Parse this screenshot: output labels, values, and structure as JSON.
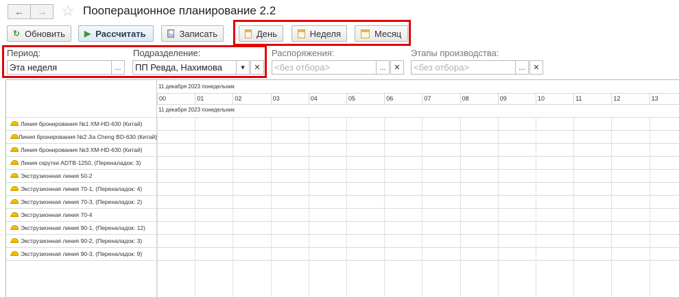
{
  "window": {
    "title": "Пооперационное планирование 2.2"
  },
  "nav": {
    "back_glyph": "←",
    "forward_glyph": "→",
    "favorite_glyph": "☆"
  },
  "toolbar": {
    "refresh_label": "Обновить",
    "calculate_label": "Рассчитать",
    "save_label": "Записать",
    "day_label": "День",
    "week_label": "Неделя",
    "month_label": "Месяц"
  },
  "filters": {
    "period": {
      "label": "Период:",
      "value": "Эта неделя"
    },
    "department": {
      "label": "Подразделение:",
      "value": "ПП Ревда, Нахимова"
    },
    "orders": {
      "label": "Распоряжения:",
      "placeholder": "<без отбора>"
    },
    "stages": {
      "label": "Этапы производства:",
      "placeholder": "<без отбора>"
    }
  },
  "gantt": {
    "date_header": "11 декабря 2023 понедельник",
    "date_subheader": "11 декабря 2023 понедельник",
    "hours": [
      "00",
      "01",
      "02",
      "03",
      "04",
      "05",
      "06",
      "07",
      "08",
      "09",
      "10",
      "11",
      "12",
      "13"
    ],
    "resources": [
      "Линия бронирования №1 XM-HD-630 (Китай)",
      "Линия бронирования №2 Jia Cheng BD-630 (Китай)",
      "Линия бронирования №3 XM-HD-630 (Китай)",
      "Линия скрутки ADTB-1250, (Переналадок: 3)",
      "Экструзионная линия 50-2",
      "Экструзионная линия 70-1, (Переналадок: 4)",
      "Экструзионная линия 70-3, (Переналадок: 2)",
      "Экструзионная линия 70-4",
      "Экструзионная линия 90-1, (Переналадок: 12)",
      "Экструзионная линия 90-2, (Переналадок: 3)",
      "Экструзионная линия 90-3, (Переналадок: 9)"
    ]
  },
  "colors": {
    "highlight_frame": "#e00000",
    "gantt_border": "#a9c98f",
    "resource_icon": "#f2c200"
  }
}
